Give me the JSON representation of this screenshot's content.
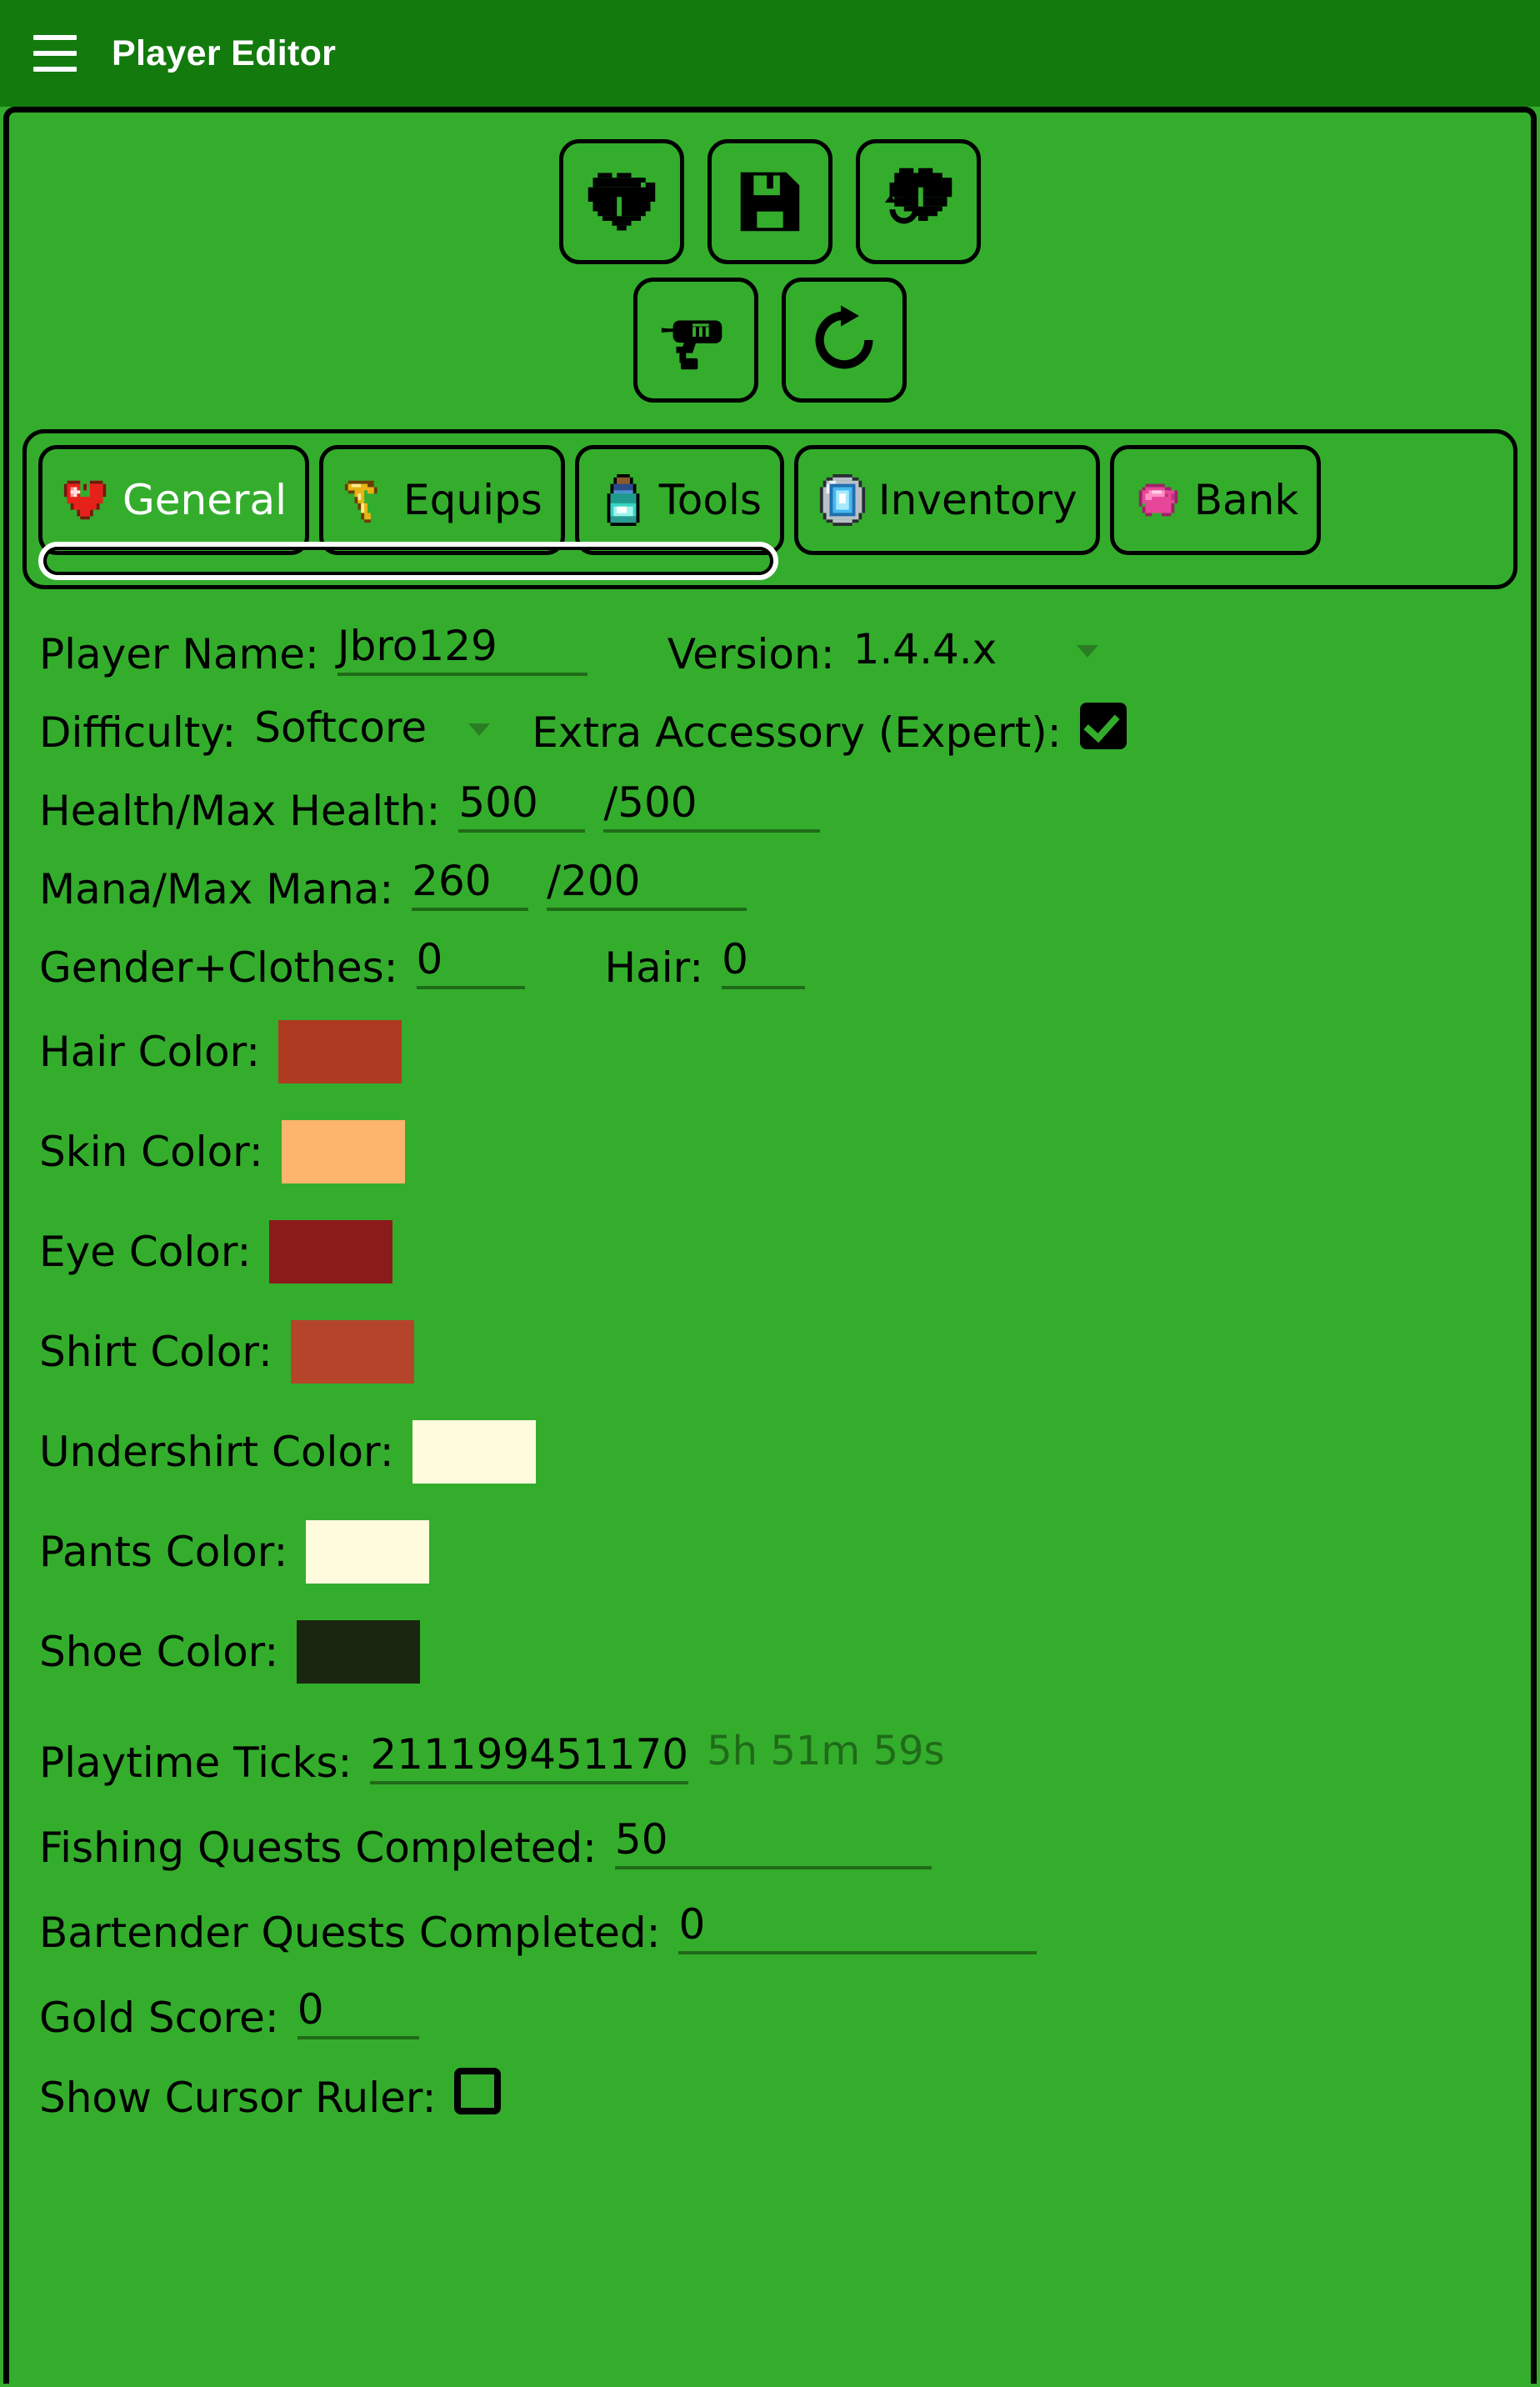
{
  "appbar": {
    "menu_icon": "hamburger-menu-icon",
    "title": "Player Editor"
  },
  "toolbar": {
    "buttons": [
      {
        "name": "open-player-file-button",
        "icon": "pixel-heart-open-icon",
        "label": "Open"
      },
      {
        "name": "save-player-button",
        "icon": "floppy-disk-save-icon",
        "label": "Save"
      },
      {
        "name": "reload-player-button",
        "icon": "pixel-heart-reload-icon",
        "label": "Reload"
      },
      {
        "name": "tools-drill-button",
        "icon": "drill-icon",
        "label": "Tools"
      },
      {
        "name": "refresh-button",
        "icon": "circular-refresh-arrow-icon",
        "label": "Refresh"
      }
    ]
  },
  "tabs": {
    "active_index": 0,
    "items": [
      {
        "label": "General",
        "icon": "red-heart-icon"
      },
      {
        "label": "Equips",
        "icon": "gold-pickaxe-icon"
      },
      {
        "label": "Tools",
        "icon": "teal-potion-bottle-icon"
      },
      {
        "label": "Inventory",
        "icon": "magic-mirror-icon"
      },
      {
        "label": "Bank",
        "icon": "pink-piggy-bank-icon"
      }
    ]
  },
  "general": {
    "player_name": {
      "label": "Player Name:",
      "value": "Jbro129"
    },
    "version": {
      "label": "Version:",
      "value": "1.4.4.x"
    },
    "difficulty": {
      "label": "Difficulty:",
      "value": "Softcore"
    },
    "extra_accessory": {
      "label": "Extra Accessory (Expert):",
      "checked": true
    },
    "health": {
      "label": "Health/Max Health:",
      "current": "500",
      "max": "/500"
    },
    "mana": {
      "label": "Mana/Max Mana:",
      "current": "260",
      "max": "/200"
    },
    "gender_clothes": {
      "label": "Gender+Clothes:",
      "value": "0"
    },
    "hair": {
      "label": "Hair:",
      "value": "0"
    },
    "colors": [
      {
        "label": "Hair Color:",
        "hex": "#AE3A22",
        "name": "hair-color-swatch"
      },
      {
        "label": "Skin Color:",
        "hex": "#FDB46C",
        "name": "skin-color-swatch"
      },
      {
        "label": "Eye Color:",
        "hex": "#8B1A1A",
        "name": "eye-color-swatch"
      },
      {
        "label": "Shirt Color:",
        "hex": "#B5452A",
        "name": "shirt-color-swatch"
      },
      {
        "label": "Undershirt Color:",
        "hex": "#FFFBDC",
        "name": "undershirt-color-swatch"
      },
      {
        "label": "Pants Color:",
        "hex": "#FFFBDC",
        "name": "pants-color-swatch"
      },
      {
        "label": "Shoe Color:",
        "hex": "#1B2610",
        "name": "shoe-color-swatch"
      }
    ],
    "playtime": {
      "label": "Playtime Ticks:",
      "value": "211199451170",
      "formatted": "5h 51m 59s"
    },
    "fishing_quests": {
      "label": "Fishing Quests Completed:",
      "value": "50"
    },
    "bartender_quests": {
      "label": "Bartender Quests Completed:",
      "value": "0"
    },
    "gold_score": {
      "label": "Gold Score:",
      "value": "0"
    },
    "cursor_ruler": {
      "label": "Show Cursor Ruler:",
      "checked": false
    }
  },
  "theme": {
    "appbar_green": "#137A0D",
    "body_green": "#34AD2D",
    "underline_green": "#1F6B18",
    "outline_black": "#000000",
    "active_tab_text": "#FFFFFF"
  }
}
